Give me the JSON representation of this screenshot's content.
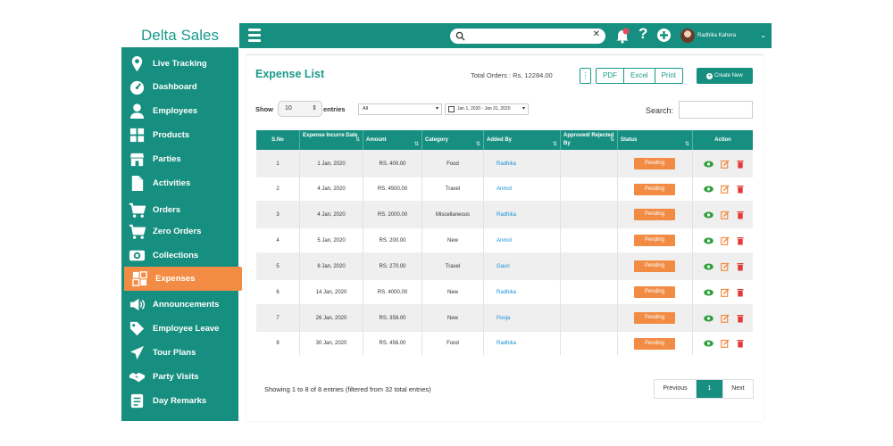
{
  "brand": "Delta Sales",
  "sidebar": {
    "items": [
      {
        "label": "Live Tracking",
        "icon": "location-pin-icon"
      },
      {
        "label": "Dashboard",
        "icon": "speedometer-icon"
      },
      {
        "label": "Employees",
        "icon": "person-icon"
      },
      {
        "label": "Products",
        "icon": "grid-icon"
      },
      {
        "label": "Parties",
        "icon": "store-icon"
      },
      {
        "label": "Activities",
        "icon": "document-icon"
      },
      {
        "label": "Orders",
        "icon": "cart-icon"
      },
      {
        "label": "Zero Orders",
        "icon": "cart-icon"
      },
      {
        "label": "Collections",
        "icon": "money-icon"
      },
      {
        "label": "Expenses",
        "icon": "expenses-icon",
        "active": true
      },
      {
        "label": "Announcements",
        "icon": "megaphone-icon"
      },
      {
        "label": "Employee Leave",
        "icon": "tag-icon"
      },
      {
        "label": "Tour Plans",
        "icon": "paper-plane-icon"
      },
      {
        "label": "Party Visits",
        "icon": "handshake-icon"
      },
      {
        "label": "Day Remarks",
        "icon": "notes-icon"
      }
    ]
  },
  "topbar": {
    "search_placeholder": "",
    "user_name": "Radhika Kahera"
  },
  "page": {
    "title": "Expense List",
    "total_orders": "Total Orders : Rs. 12284.00",
    "pdf_label": "PDF",
    "excel_label": "Excel",
    "print_label": "Print",
    "create_label": "Create New",
    "show_label": "Show",
    "show_value": "10",
    "entries_label": "entries",
    "filter_value": "All",
    "date_range": "Jan 1, 2020 - Jan 31, 2020",
    "search_label": "Search:"
  },
  "table": {
    "headers": [
      "S.No",
      "Expense Incurre Date",
      "Amount",
      "Category",
      "Added By",
      "Approved/ Rejected By",
      "Status",
      "Action"
    ],
    "rows": [
      {
        "sno": "1",
        "date": "1 Jan, 2020",
        "amount": "RS. 400.00",
        "category": "Food",
        "added_by": "Radhika",
        "approved_by": "",
        "status": "Pending"
      },
      {
        "sno": "2",
        "date": "4 Jan, 2020",
        "amount": "RS. 4500.00",
        "category": "Travel",
        "added_by": "Anmol",
        "approved_by": "",
        "status": "Pending"
      },
      {
        "sno": "3",
        "date": "4 Jan, 2020",
        "amount": "RS. 2000.00",
        "category": "Miscellaneous",
        "added_by": "Radhika",
        "approved_by": "",
        "status": "Pending"
      },
      {
        "sno": "4",
        "date": "5 Jan, 2020",
        "amount": "RS. 200.00",
        "category": "New",
        "added_by": "Anmol",
        "approved_by": "",
        "status": "Pending"
      },
      {
        "sno": "5",
        "date": "8 Jan, 2020",
        "amount": "RS. 270.00",
        "category": "Travel",
        "added_by": "Gauri",
        "approved_by": "",
        "status": "Pending"
      },
      {
        "sno": "6",
        "date": "14 Jan, 2020",
        "amount": "RS. 4000.00",
        "category": "New",
        "added_by": "Radhika",
        "approved_by": "",
        "status": "Pending"
      },
      {
        "sno": "7",
        "date": "26 Jan, 2020",
        "amount": "RS. 358.00",
        "category": "New",
        "added_by": "Pooja",
        "approved_by": "",
        "status": "Pending"
      },
      {
        "sno": "8",
        "date": "30 Jan, 2020",
        "amount": "RS. 456.00",
        "category": "Food",
        "added_by": "Radhika",
        "approved_by": "",
        "status": "Pending"
      }
    ]
  },
  "footer": {
    "info": "Showing 1 to 8 of 8 entries (filtered from 32 total entries)",
    "prev": "Previous",
    "page": "1",
    "next": "Next"
  },
  "colors": {
    "teal": "#178f80",
    "orange": "#f28c44",
    "link": "#1a8fd6"
  }
}
